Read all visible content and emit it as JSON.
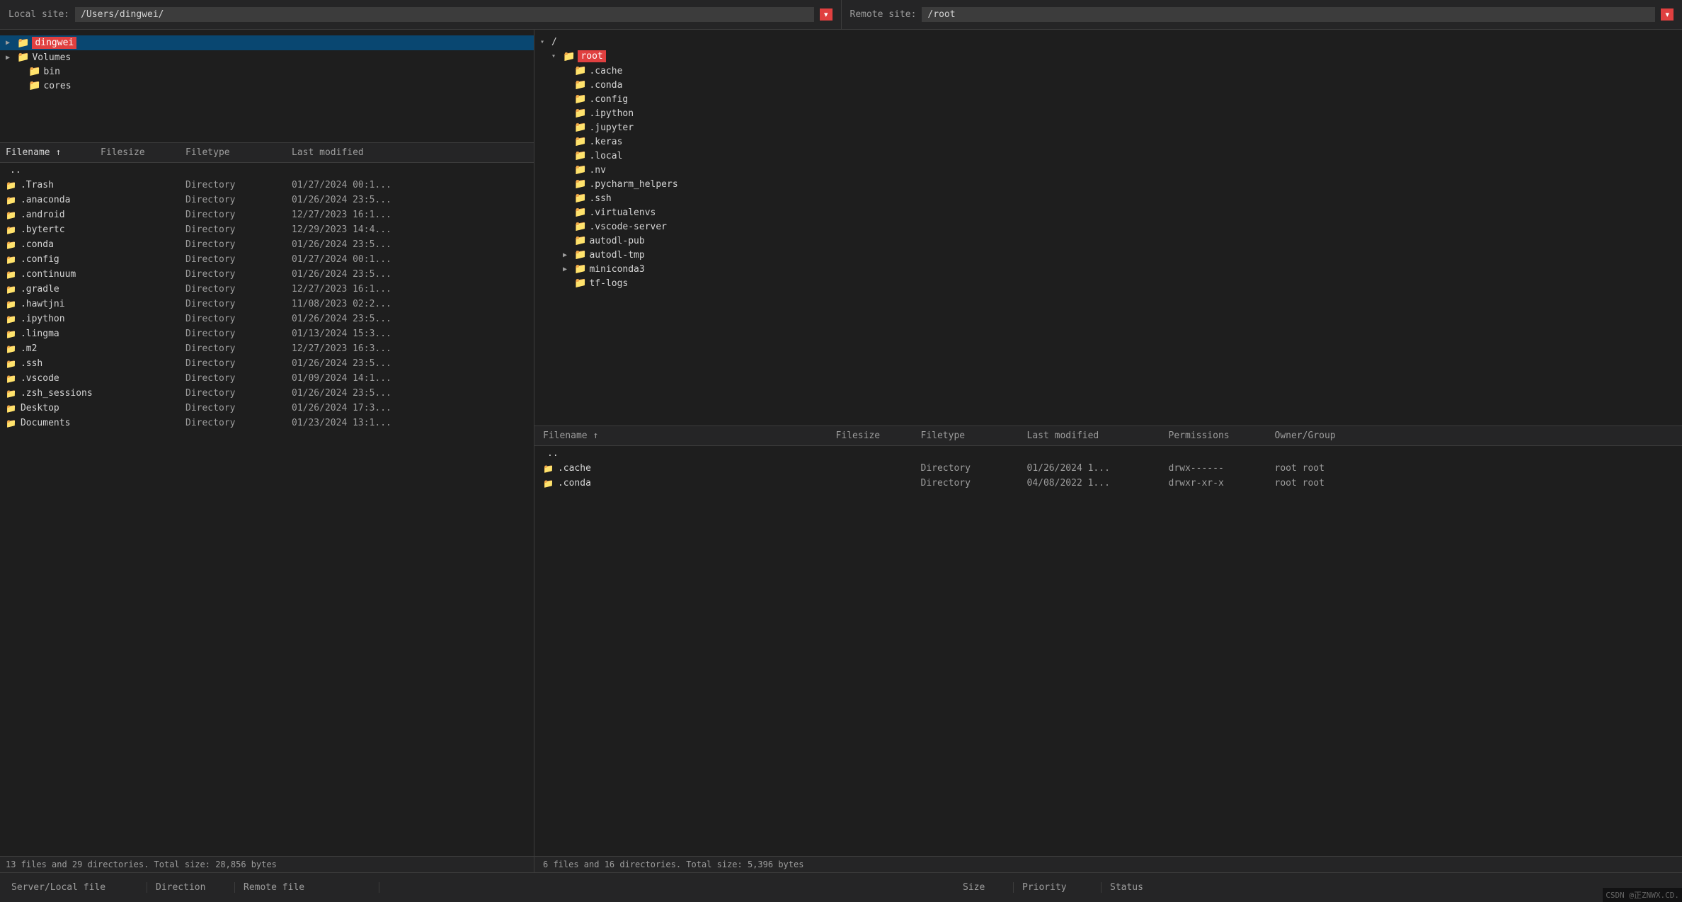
{
  "local_site": {
    "label": "Local site:",
    "path": "/Users/dingwei/",
    "dropdown_icon": "▾"
  },
  "remote_site": {
    "label": "Remote site:",
    "path": "/root",
    "dropdown_icon": "▾"
  },
  "local_tree": {
    "items": [
      {
        "level": 1,
        "arrow": "▶",
        "label": "dingwei",
        "selected": true
      },
      {
        "level": 1,
        "arrow": "▶",
        "label": "Volumes",
        "selected": false
      },
      {
        "level": 2,
        "arrow": "",
        "label": "bin",
        "selected": false
      },
      {
        "level": 2,
        "arrow": "",
        "label": "cores",
        "selected": false
      }
    ]
  },
  "local_file_list": {
    "headers": [
      {
        "label": "Filename",
        "active": true,
        "sort_arrow": "↑"
      },
      {
        "label": "Filesize",
        "active": false
      },
      {
        "label": "Filetype",
        "active": false
      },
      {
        "label": "Last modified",
        "active": false
      },
      {
        "label": "",
        "active": false
      }
    ],
    "files": [
      {
        "name": "..",
        "type": "",
        "date": "",
        "size": ""
      },
      {
        "name": ".Trash",
        "type": "Directory",
        "date": "01/27/2024 00:1...",
        "size": ""
      },
      {
        "name": ".anaconda",
        "type": "Directory",
        "date": "01/26/2024 23:5...",
        "size": ""
      },
      {
        "name": ".android",
        "type": "Directory",
        "date": "12/27/2023 16:1...",
        "size": ""
      },
      {
        "name": ".bytertc",
        "type": "Directory",
        "date": "12/29/2023 14:4...",
        "size": ""
      },
      {
        "name": ".conda",
        "type": "Directory",
        "date": "01/26/2024 23:5...",
        "size": ""
      },
      {
        "name": ".config",
        "type": "Directory",
        "date": "01/27/2024 00:1...",
        "size": ""
      },
      {
        "name": ".continuum",
        "type": "Directory",
        "date": "01/26/2024 23:5...",
        "size": ""
      },
      {
        "name": ".gradle",
        "type": "Directory",
        "date": "12/27/2023 16:1...",
        "size": ""
      },
      {
        "name": ".hawtjni",
        "type": "Directory",
        "date": "11/08/2023 02:2...",
        "size": ""
      },
      {
        "name": ".ipython",
        "type": "Directory",
        "date": "01/26/2024 23:5...",
        "size": ""
      },
      {
        "name": ".lingma",
        "type": "Directory",
        "date": "01/13/2024 15:3...",
        "size": ""
      },
      {
        "name": ".m2",
        "type": "Directory",
        "date": "12/27/2023 16:3...",
        "size": ""
      },
      {
        "name": ".ssh",
        "type": "Directory",
        "date": "01/26/2024 23:5...",
        "size": ""
      },
      {
        "name": ".vscode",
        "type": "Directory",
        "date": "01/09/2024 14:1...",
        "size": ""
      },
      {
        "name": ".zsh_sessions",
        "type": "Directory",
        "date": "01/26/2024 23:5...",
        "size": ""
      },
      {
        "name": "Desktop",
        "type": "Directory",
        "date": "01/26/2024 17:3...",
        "size": ""
      },
      {
        "name": "Documents",
        "type": "Directory",
        "date": "01/23/2024 13:1...",
        "size": ""
      }
    ],
    "status": "13 files and 29 directories. Total size: 28,856 bytes"
  },
  "remote_tree": {
    "items": [
      {
        "level": 0,
        "arrow": "▾",
        "label": "/",
        "selected": false,
        "is_root": true
      },
      {
        "level": 1,
        "arrow": "▾",
        "label": "root",
        "selected": true,
        "highlighted": true
      },
      {
        "level": 2,
        "arrow": "",
        "label": ".cache",
        "selected": false
      },
      {
        "level": 2,
        "arrow": "",
        "label": ".conda",
        "selected": false
      },
      {
        "level": 2,
        "arrow": "",
        "label": ".config",
        "selected": false
      },
      {
        "level": 2,
        "arrow": "",
        "label": ".ipython",
        "selected": false
      },
      {
        "level": 2,
        "arrow": "",
        "label": ".jupyter",
        "selected": false
      },
      {
        "level": 2,
        "arrow": "",
        "label": ".keras",
        "selected": false
      },
      {
        "level": 2,
        "arrow": "",
        "label": ".local",
        "selected": false
      },
      {
        "level": 2,
        "arrow": "",
        "label": ".nv",
        "selected": false
      },
      {
        "level": 2,
        "arrow": "",
        "label": ".pycharm_helpers",
        "selected": false
      },
      {
        "level": 2,
        "arrow": "",
        "label": ".ssh",
        "selected": false
      },
      {
        "level": 2,
        "arrow": "",
        "label": ".virtualenvs",
        "selected": false
      },
      {
        "level": 2,
        "arrow": "",
        "label": ".vscode-server",
        "selected": false
      },
      {
        "level": 2,
        "arrow": "",
        "label": "autodl-pub",
        "selected": false
      },
      {
        "level": 2,
        "arrow": "▶",
        "label": "autodl-tmp",
        "selected": false
      },
      {
        "level": 2,
        "arrow": "▶",
        "label": "miniconda3",
        "selected": false
      },
      {
        "level": 2,
        "arrow": "",
        "label": "tf-logs",
        "selected": false
      }
    ]
  },
  "remote_file_list": {
    "headers": [
      {
        "label": "Filename",
        "active": true,
        "sort_arrow": "↑"
      },
      {
        "label": "Filesize",
        "active": false
      },
      {
        "label": "Filetype",
        "active": false
      },
      {
        "label": "Last modified",
        "active": false
      },
      {
        "label": "Permissions",
        "active": false
      },
      {
        "label": "Owner/Group",
        "active": false
      },
      {
        "label": "",
        "active": false
      }
    ],
    "files": [
      {
        "name": "..",
        "size": "",
        "type": "",
        "date": "",
        "perms": "",
        "owner": ""
      },
      {
        "name": ".cache",
        "size": "",
        "type": "Directory",
        "date": "01/26/2024 1...",
        "perms": "drwx------",
        "owner": "root root"
      },
      {
        "name": ".conda",
        "size": "",
        "type": "Directory",
        "date": "04/08/2022 1...",
        "perms": "drwxr-xr-x",
        "owner": "root root"
      }
    ],
    "status": "6 files and 16 directories. Total size: 5,396 bytes"
  },
  "transfer_bar": {
    "cols": [
      {
        "label": "Server/Local file"
      },
      {
        "label": "Direction"
      },
      {
        "label": "Remote file"
      },
      {
        "label": ""
      },
      {
        "label": "Size"
      },
      {
        "label": "Priority"
      },
      {
        "label": "Status"
      }
    ]
  },
  "watermark": "CSDN @正ZNWX.CD."
}
